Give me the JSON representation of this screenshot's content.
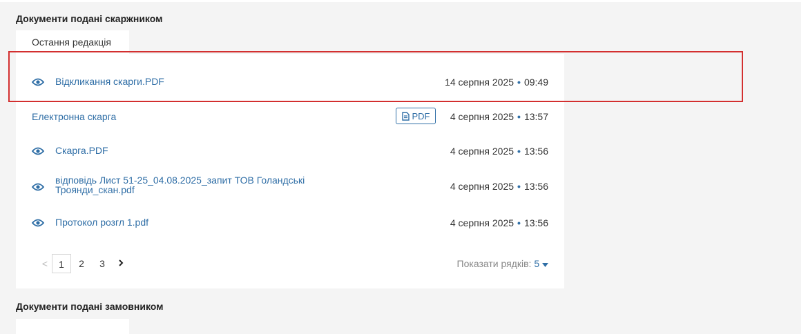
{
  "complainant_section": {
    "title": "Документи подані скаржником",
    "tab_label": "Остання редакція",
    "documents": [
      {
        "name": "Відкликання скарги.PDF",
        "date": "14 серпня 2025",
        "time": "09:49"
      },
      {
        "name": "Електронна скарга",
        "badge": "PDF",
        "date": "4 серпня 2025",
        "time": "13:57"
      },
      {
        "name": "Скарга.PDF",
        "date": "4 серпня 2025",
        "time": "13:56"
      },
      {
        "name": "відповідь Лист 51-25_04.08.2025_запит ТОВ Голандські Троянди_скан.pdf",
        "date": "4 серпня 2025",
        "time": "13:56"
      },
      {
        "name": "Протокол розгл 1.pdf",
        "date": "4 серпня 2025",
        "time": "13:56"
      }
    ],
    "pagination": {
      "prev": "<",
      "pages": [
        "1",
        "2",
        "3"
      ],
      "current_page": "1",
      "next": ">"
    },
    "rows_per_page": {
      "label": "Показати рядків:",
      "value": "5"
    }
  },
  "customer_section": {
    "title": "Документи подані замовником"
  },
  "colors": {
    "link": "#2f6ea6",
    "highlight": "#d32f2f",
    "panel_bg": "#f4f4f4"
  },
  "icons": {
    "view": "eye-icon",
    "file": "file-icon",
    "next": "chevron-right-icon",
    "prev": "chevron-left-icon",
    "dropdown": "caret-down-icon"
  }
}
